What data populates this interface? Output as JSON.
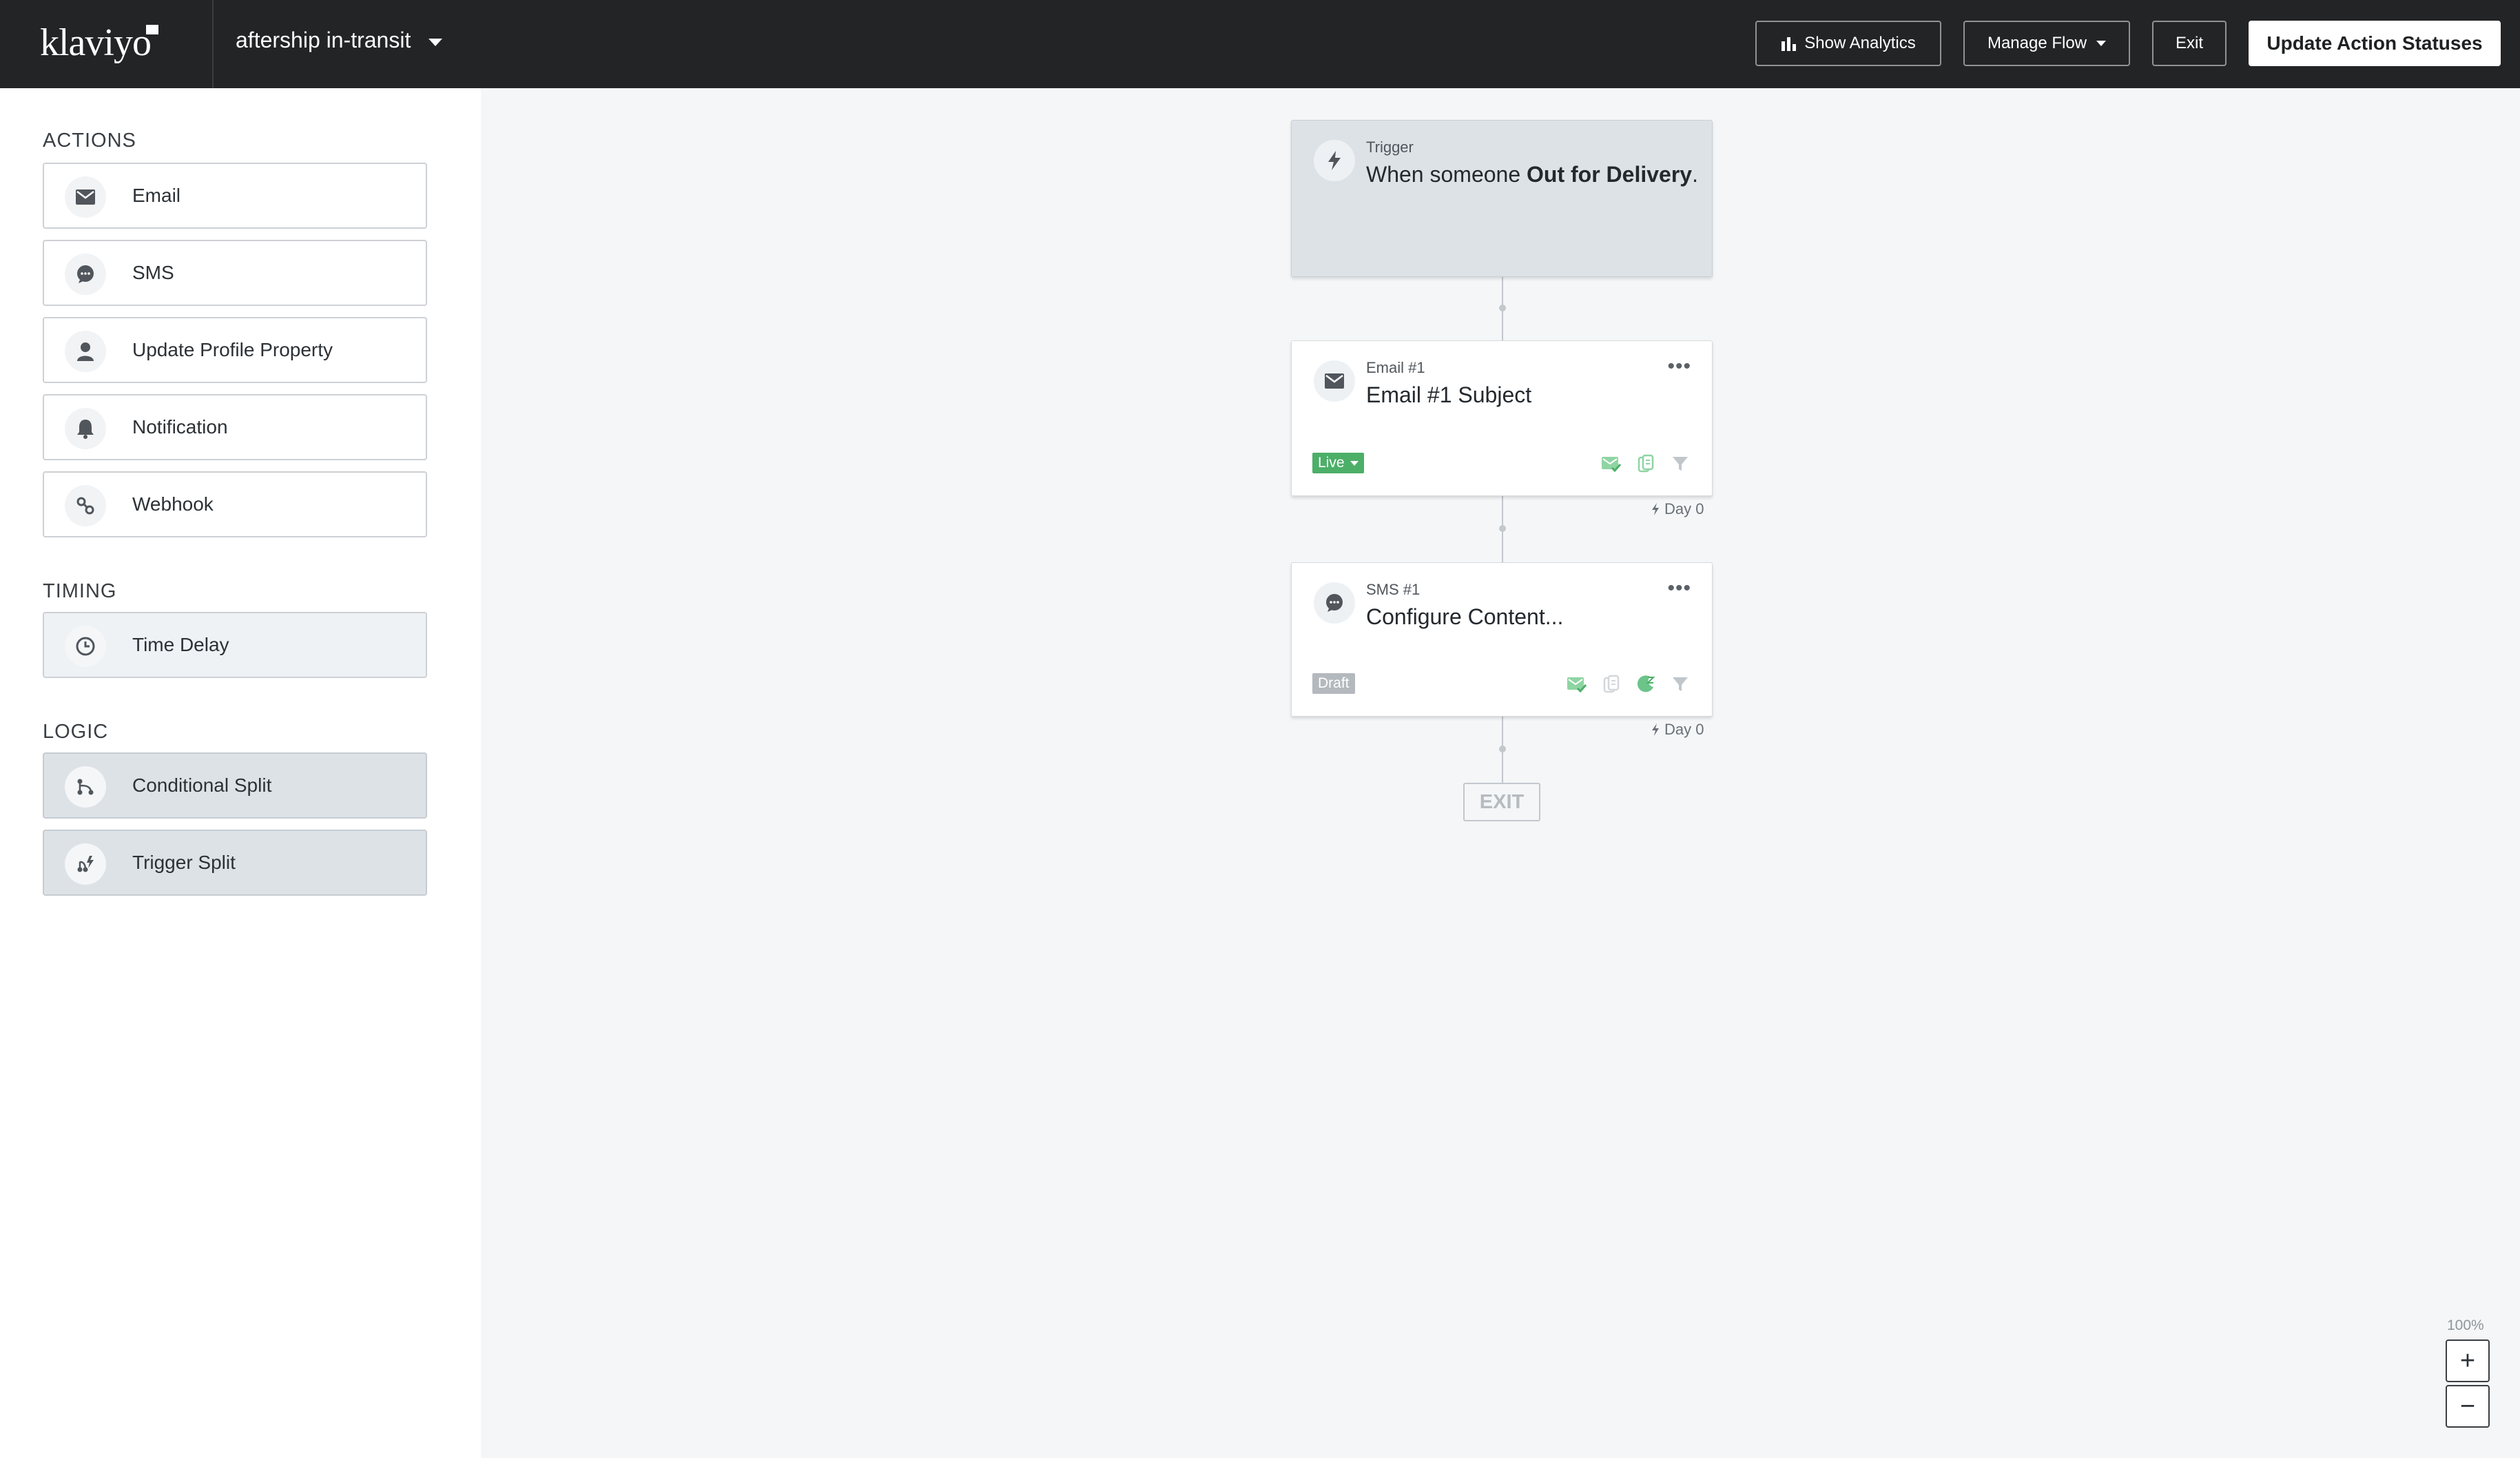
{
  "header": {
    "logo": "klaviyo",
    "flow_name": "aftership in-transit",
    "show_analytics": "Show Analytics",
    "manage_flow": "Manage Flow",
    "exit": "Exit",
    "update_statuses": "Update Action Statuses"
  },
  "sidebar": {
    "actions_title": "ACTIONS",
    "actions": [
      {
        "label": "Email",
        "icon": "envelope-icon"
      },
      {
        "label": "SMS",
        "icon": "chat-bubble-icon"
      },
      {
        "label": "Update Profile Property",
        "icon": "person-icon"
      },
      {
        "label": "Notification",
        "icon": "bell-icon"
      },
      {
        "label": "Webhook",
        "icon": "webhook-icon"
      }
    ],
    "timing_title": "TIMING",
    "timing": [
      {
        "label": "Time Delay",
        "icon": "clock-icon"
      }
    ],
    "logic_title": "LOGIC",
    "logic": [
      {
        "label": "Conditional Split",
        "icon": "split-icon"
      },
      {
        "label": "Trigger Split",
        "icon": "trigger-split-icon"
      }
    ]
  },
  "canvas": {
    "trigger": {
      "type": "Trigger",
      "prefix": "When someone",
      "event": "Out for Delivery",
      "suffix": "."
    },
    "email_node": {
      "type": "Email #1",
      "title": "Email #1 Subject",
      "status": "Live",
      "day": "Day 0"
    },
    "sms_node": {
      "type": "SMS #1",
      "title": "Configure Content...",
      "status": "Draft",
      "day": "Day 0"
    },
    "exit_label": "EXIT"
  },
  "zoom": {
    "level": "100%",
    "plus": "+",
    "minus": "−"
  },
  "colors": {
    "header_bg": "#232426",
    "live_green": "#4caf68",
    "canvas_bg": "#f4f6f8"
  }
}
